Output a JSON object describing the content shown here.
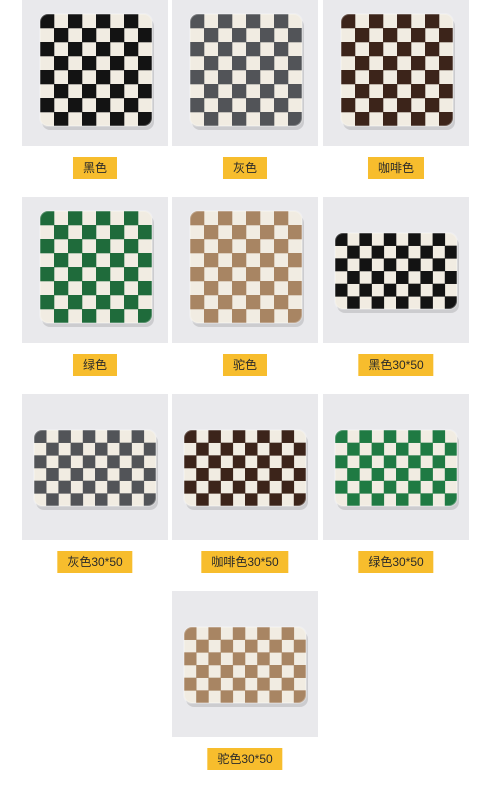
{
  "products": [
    {
      "label": "黑色",
      "color": "#131313",
      "shape": "square"
    },
    {
      "label": "灰色",
      "color": "#525458",
      "shape": "square"
    },
    {
      "label": "咖啡色",
      "color": "#3c241a",
      "shape": "square"
    },
    {
      "label": "绿色",
      "color": "#1f6b3b",
      "shape": "square"
    },
    {
      "label": "驼色",
      "color": "#a88563",
      "shape": "square"
    },
    {
      "label": "黑色30*50",
      "color": "#131313",
      "shape": "rect"
    },
    {
      "label": "灰色30*50",
      "color": "#525458",
      "shape": "rect"
    },
    {
      "label": "咖啡色30*50",
      "color": "#3c241a",
      "shape": "rect"
    },
    {
      "label": "绿色30*50",
      "color": "#1f7a43",
      "shape": "rect"
    },
    {
      "label": "驼色30*50",
      "color": "#a88563",
      "shape": "rect"
    }
  ],
  "colors": {
    "label_bg": "#f7bd2d",
    "photo_bg": "#e9e9ec",
    "cream": "#f1ece2"
  }
}
